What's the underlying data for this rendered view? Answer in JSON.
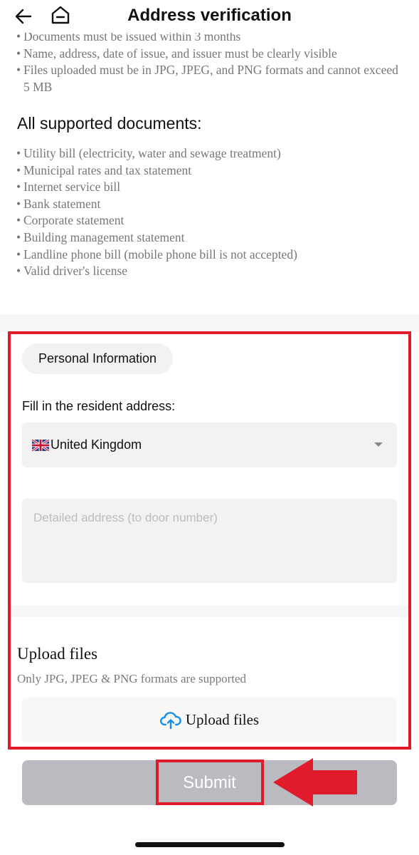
{
  "header": {
    "title": "Address verification"
  },
  "requirements": [
    "Documents must be issued within 3 months",
    "Name, address, date of issue, and issuer must be clearly visible",
    "Files uploaded must be in JPG, JPEG, and PNG formats and cannot exceed 5 MB"
  ],
  "supported": {
    "heading": "All supported documents:",
    "items": [
      "Utility bill (electricity, water and sewage treatment)",
      "Municipal rates and tax statement",
      "Internet service bill",
      "Bank statement",
      "Corporate statement",
      "Building management statement",
      "Landline phone bill (mobile phone bill is not accepted)",
      "Valid driver's license"
    ]
  },
  "form": {
    "section_label": "Personal Information",
    "address_label": "Fill in the resident address:",
    "country": "United Kingdom",
    "detail_placeholder": "Detailed address (to door number)"
  },
  "upload": {
    "heading": "Upload files",
    "note": "Only JPG, JPEG & PNG formats are supported",
    "button_label": "Upload files"
  },
  "submit_label": "Submit",
  "colors": {
    "highlight": "#e01b2c",
    "submit_bg": "#b9bbc0",
    "upload_icon": "#1a8fe3"
  }
}
